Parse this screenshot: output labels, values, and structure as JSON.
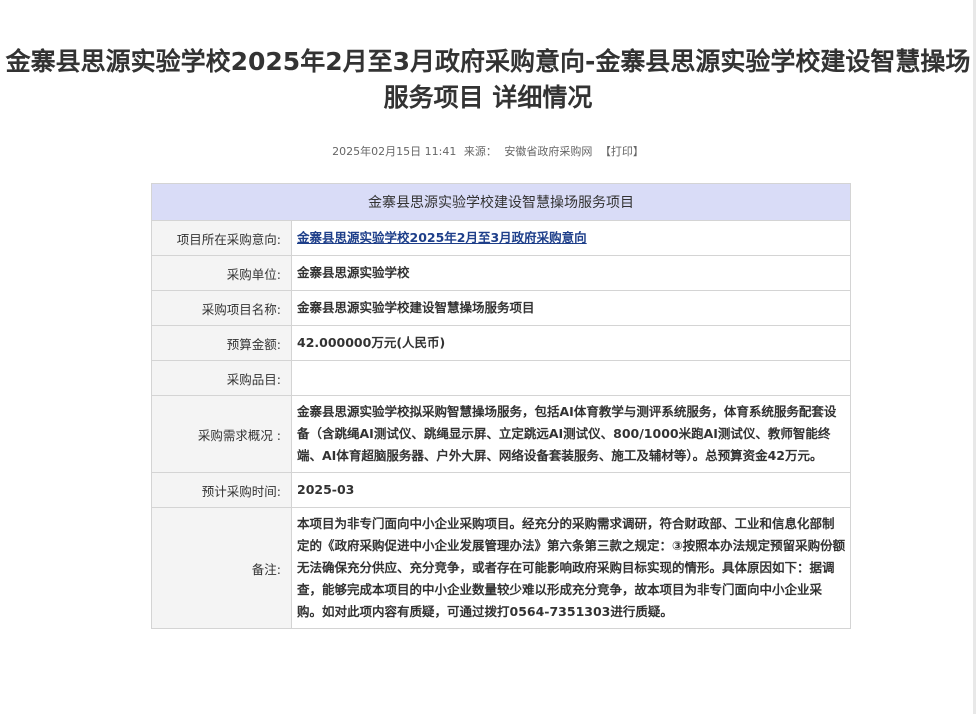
{
  "page": {
    "title": "金寨县思源实验学校2025年2月至3月政府采购意向-金寨县思源实验学校建设智慧操场服务项目 详细情况",
    "meta": {
      "datetime": "2025年02月15日 11:41",
      "source_label": "来源：",
      "source": "安徽省政府采购网",
      "print_label": "【打印】"
    }
  },
  "detail_table": {
    "caption": "金寨县思源实验学校建设智慧操场服务项目",
    "rows": [
      {
        "label": "项目所在采购意向:",
        "value": "金寨县思源实验学校2025年2月至3月政府采购意向"
      },
      {
        "label": "采购单位:",
        "value": "金寨县思源实验学校"
      },
      {
        "label": "采购项目名称:",
        "value": "金寨县思源实验学校建设智慧操场服务项目"
      },
      {
        "label": "预算金额:",
        "value": "42.000000万元(人民币)"
      },
      {
        "label": "采购品目:",
        "value": ""
      },
      {
        "label": "采购需求概况 :",
        "value": "金寨县思源实验学校拟采购智慧操场服务，包括AI体育教学与测评系统服务，体育系统服务配套设备（含跳绳AI测试仪、跳绳显示屏、立定跳远AI测试仪、800/1000米跑AI测试仪、教师智能终端、AI体育超脑服务器、户外大屏、网络设备套装服务、施工及辅材等）。总预算资金42万元。"
      },
      {
        "label": "预计采购时间:",
        "value": "2025-03"
      },
      {
        "label": "备注:",
        "value": "本项目为非专门面向中小企业采购项目。经充分的采购需求调研，符合财政部、工业和信息化部制定的《政府采购促进中小企业发展管理办法》第六条第三款之规定：③按照本办法规定预留采购份额无法确保充分供应、充分竞争，或者存在可能影响政府采购目标实现的情形。具体原因如下：据调查，能够完成本项目的中小企业数量较少难以形成充分竞争，故本项目为非专门面向中小企业采购。如对此项内容有质疑，可通过拨打0564-7351303进行质疑。"
      }
    ]
  }
}
